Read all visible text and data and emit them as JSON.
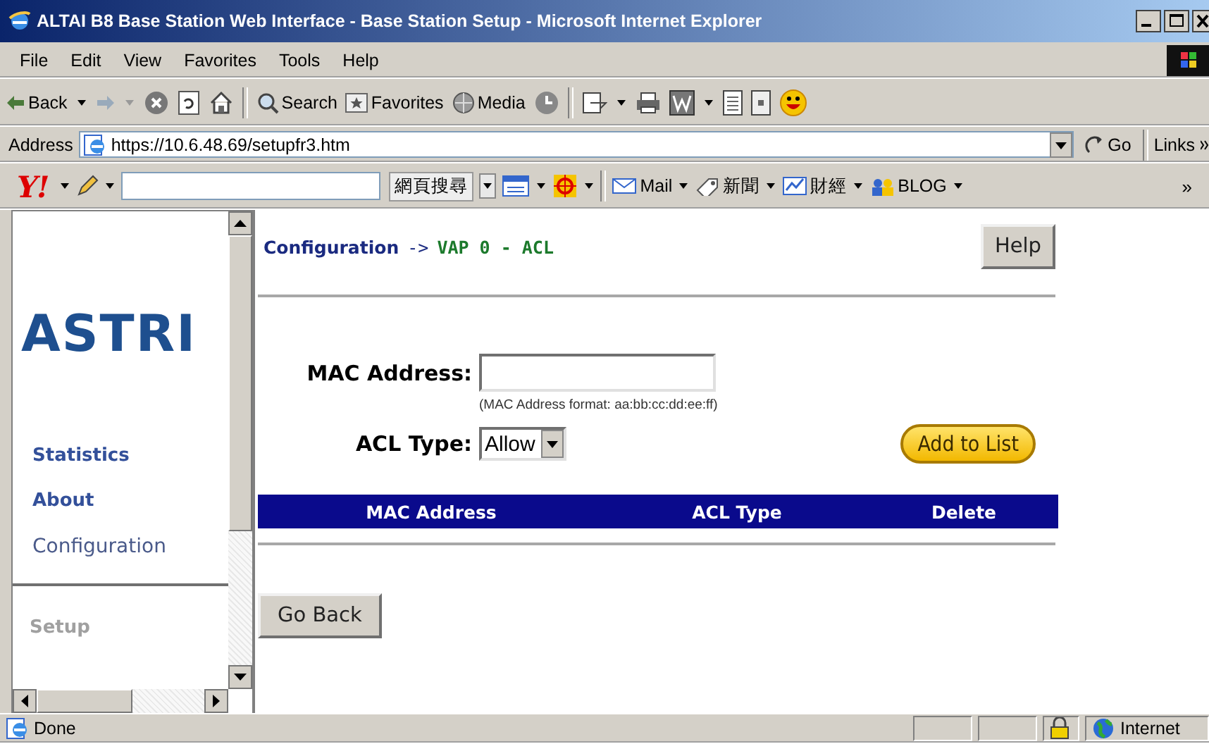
{
  "window": {
    "title": "ALTAI B8 Base Station Web Interface - Base Station Setup - Microsoft Internet Explorer"
  },
  "menu": [
    "File",
    "Edit",
    "View",
    "Favorites",
    "Tools",
    "Help"
  ],
  "toolbar": {
    "back": "Back",
    "search": "Search",
    "favorites": "Favorites",
    "media": "Media"
  },
  "address_bar": {
    "label": "Address",
    "url": "https://10.6.48.69/setupfr3.htm",
    "go": "Go",
    "links": "Links"
  },
  "yahoo_bar": {
    "logo": "Y!",
    "search_button": "網頁搜尋",
    "mail": "Mail",
    "news": "新聞",
    "finance": "財經",
    "blog": "BLOG",
    "more": "»"
  },
  "sidebar": {
    "logo": "ASTRI",
    "items": [
      {
        "label": "Statistics",
        "kind": "bold"
      },
      {
        "label": "About",
        "kind": "bold"
      },
      {
        "label": "Configuration",
        "kind": "regular"
      }
    ],
    "section": {
      "label": "Setup",
      "disabled": true
    }
  },
  "page": {
    "breadcrumb": {
      "parent": "Configuration",
      "arrow": "->",
      "current": "VAP 0 - ACL"
    },
    "help_button": "Help",
    "mac_field": {
      "label": "MAC Address:",
      "hint": "(MAC Address format: aa:bb:cc:dd:ee:ff)"
    },
    "acl_type": {
      "label": "ACL Type:",
      "value": "Allow"
    },
    "add_button": "Add to List",
    "table": {
      "columns": [
        "MAC Address",
        "ACL Type",
        "Delete"
      ]
    },
    "back_button": "Go Back"
  },
  "status_bar": {
    "text": "Done",
    "zone": "Internet"
  }
}
